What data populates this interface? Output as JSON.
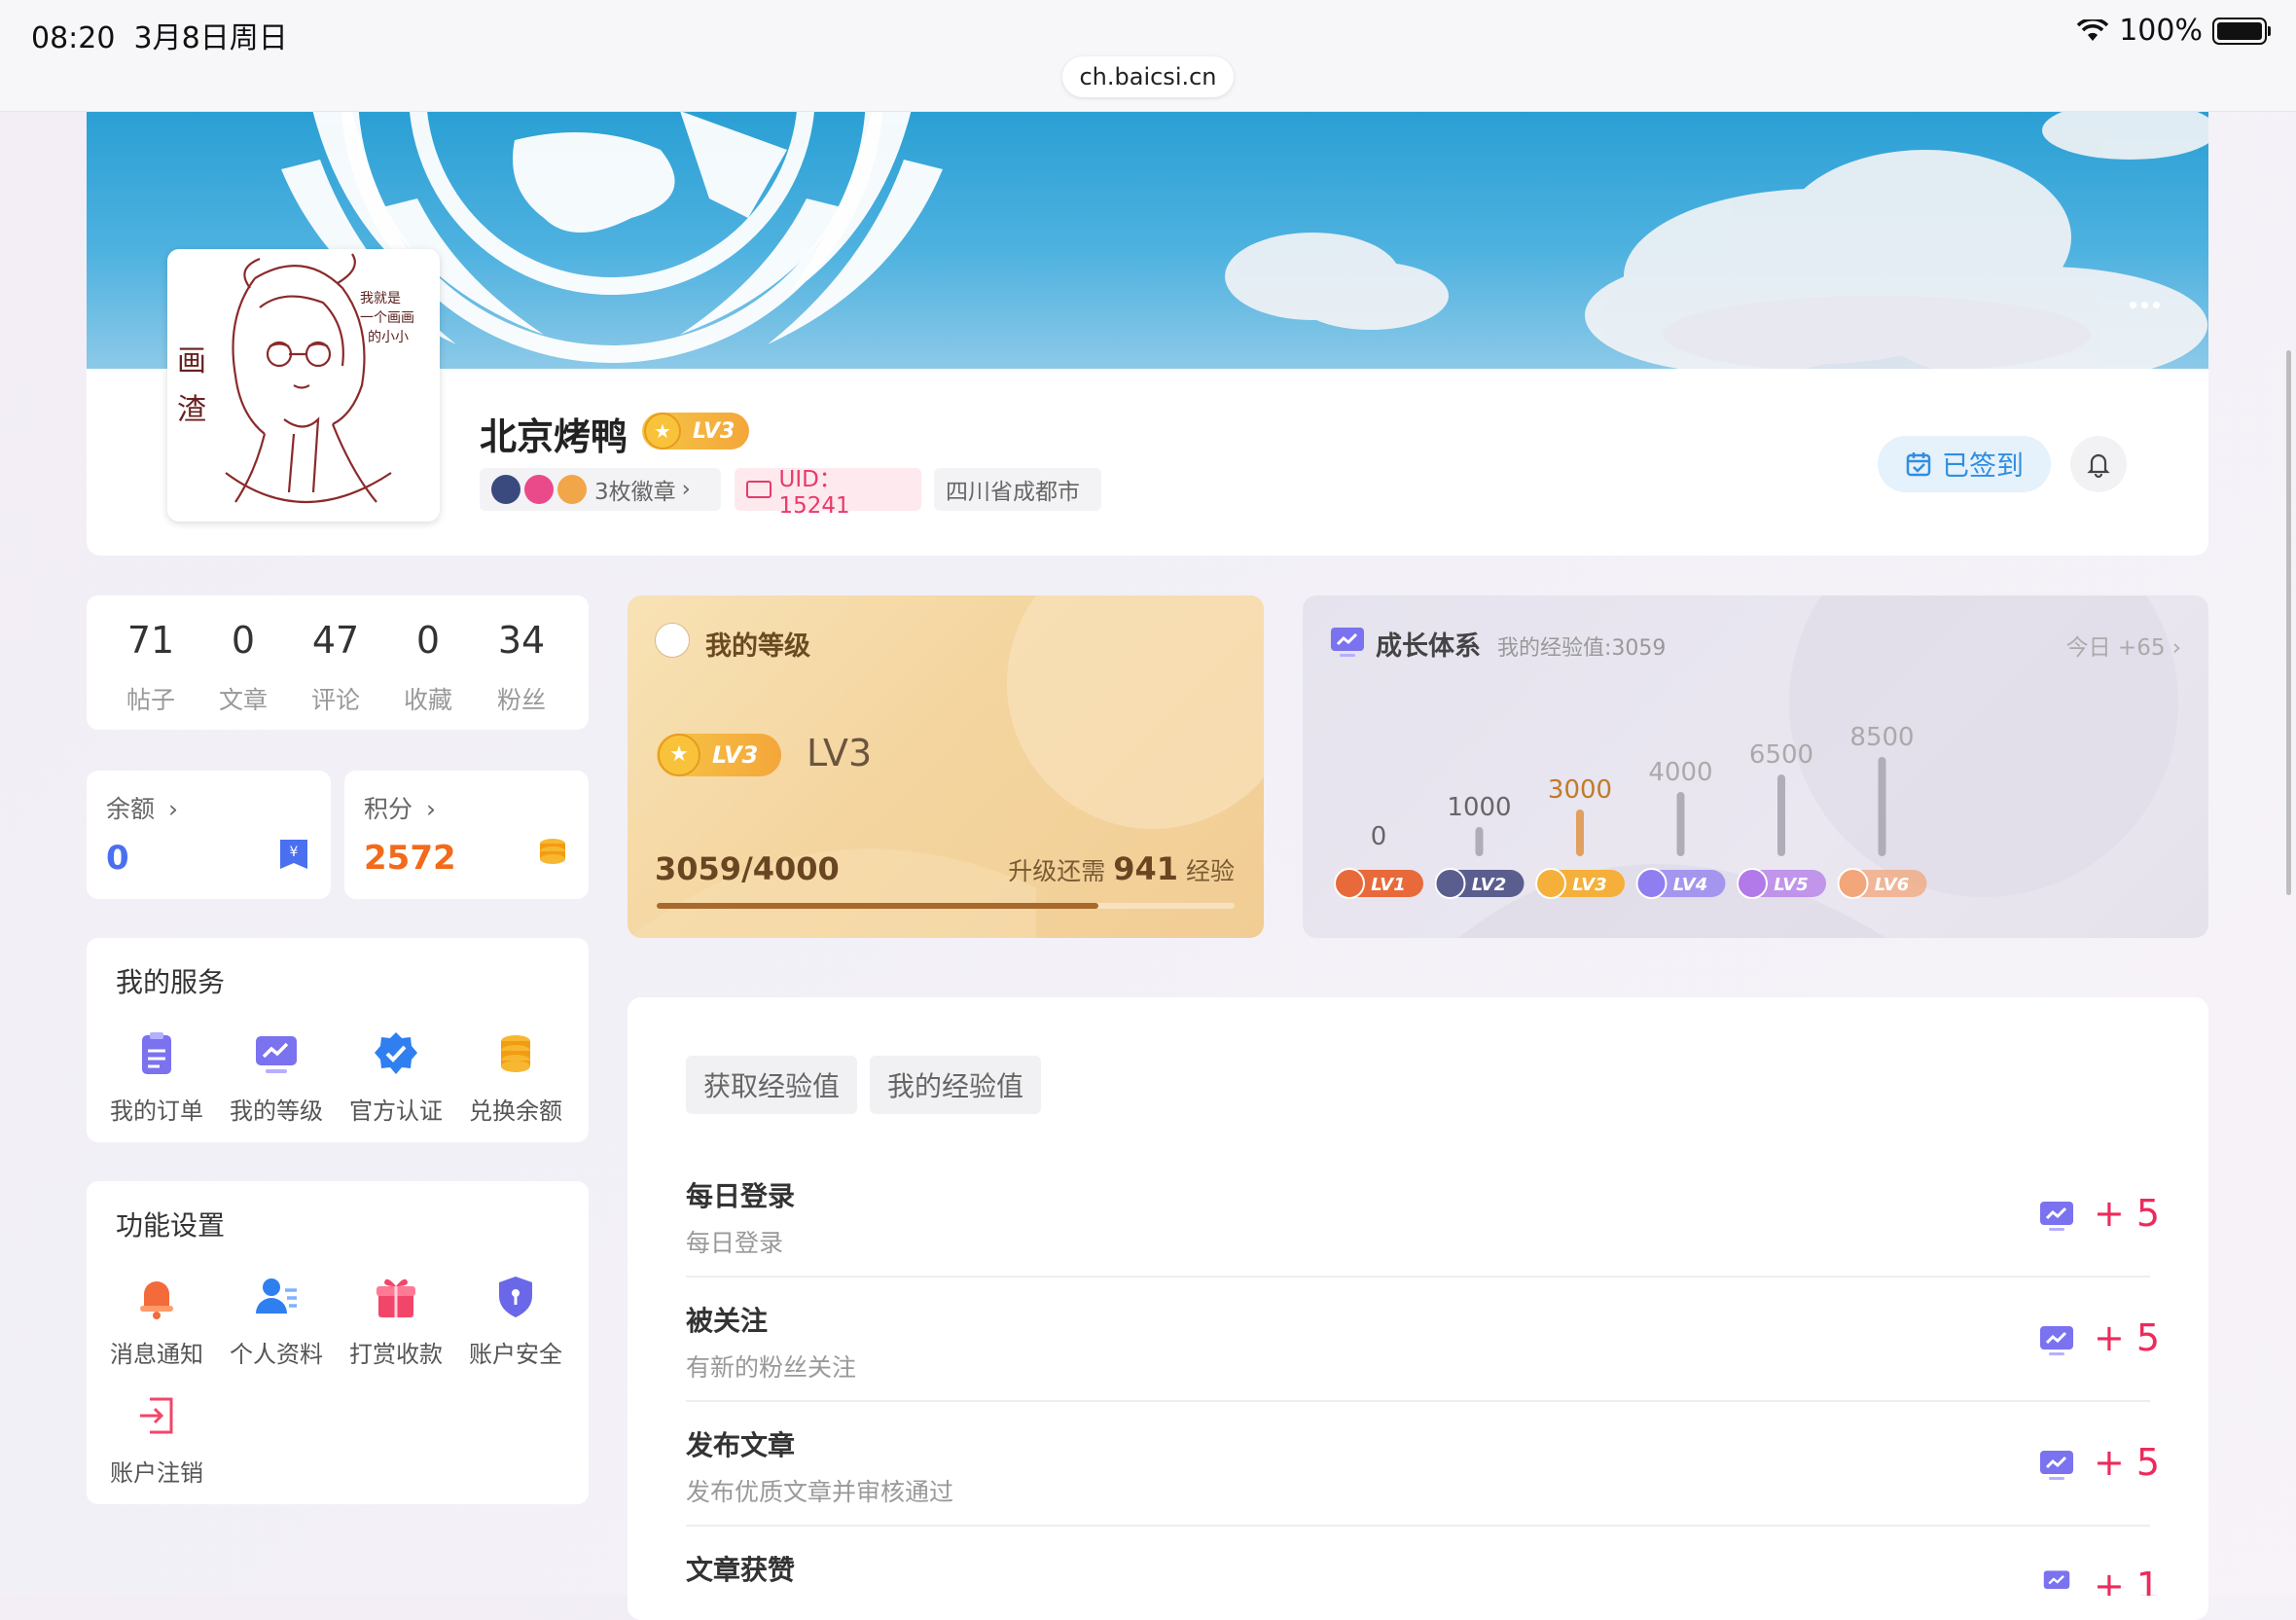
{
  "status_bar": {
    "time": "08:20",
    "date": "3月8日周日",
    "battery": "100%",
    "url": "ch.baicsi.cn"
  },
  "profile": {
    "username": "北京烤鸭",
    "level_badge": "LV3",
    "badges_label": "3枚徽章",
    "uid_label": "UID：15241",
    "location": "四川省成都市",
    "checkin_label": "已签到",
    "avatar_text": [
      "我就是",
      "一个画画",
      "的小小",
      "画",
      "渣"
    ]
  },
  "stats": [
    {
      "value": "71",
      "label": "帖子"
    },
    {
      "value": "0",
      "label": "文章"
    },
    {
      "value": "47",
      "label": "评论"
    },
    {
      "value": "0",
      "label": "收藏"
    },
    {
      "value": "34",
      "label": "粉丝"
    }
  ],
  "wallet": {
    "balance_label": "余额",
    "balance_value": "0",
    "points_label": "积分",
    "points_value": "2572"
  },
  "services": {
    "title": "我的服务",
    "items": [
      {
        "label": "我的订单",
        "icon": "order-icon"
      },
      {
        "label": "我的等级",
        "icon": "level-chart-icon"
      },
      {
        "label": "官方认证",
        "icon": "verified-icon"
      },
      {
        "label": "兑换余额",
        "icon": "coins-icon"
      }
    ]
  },
  "settings": {
    "title": "功能设置",
    "items": [
      {
        "label": "消息通知",
        "icon": "bell-icon"
      },
      {
        "label": "个人资料",
        "icon": "profile-icon"
      },
      {
        "label": "打赏收款",
        "icon": "gift-icon"
      },
      {
        "label": "账户安全",
        "icon": "shield-icon"
      },
      {
        "label": "账户注销",
        "icon": "logout-icon"
      }
    ]
  },
  "level_card": {
    "title": "我的等级",
    "badge": "LV3",
    "level": "LV3",
    "progress_text": "3059/4000",
    "need_prefix": "升级还需",
    "need_value": "941",
    "need_suffix": "经验",
    "progress": 0.7648
  },
  "growth": {
    "title": "成长体系",
    "subtitle": "我的经验值:3059",
    "today": "今日 +65",
    "levels": [
      {
        "badge": "LV1",
        "threshold": "0",
        "color": "#e86a3a"
      },
      {
        "badge": "LV2",
        "threshold": "1000",
        "color": "#5a5e8e"
      },
      {
        "badge": "LV3",
        "threshold": "3000",
        "color": "#f4b03a"
      },
      {
        "badge": "LV4",
        "threshold": "4000",
        "color": "#8f7ef0"
      },
      {
        "badge": "LV5",
        "threshold": "6500",
        "color": "#b27ae8"
      },
      {
        "badge": "LV6",
        "threshold": "8500",
        "color": "#f2a67a"
      }
    ]
  },
  "experience": {
    "tabs": [
      "获取经验值",
      "我的经验值"
    ],
    "tasks": [
      {
        "title": "每日登录",
        "desc": "每日登录",
        "points": "+ 5"
      },
      {
        "title": "被关注",
        "desc": "有新的粉丝关注",
        "points": "+ 5"
      },
      {
        "title": "发布文章",
        "desc": "发布优质文章并审核通过",
        "points": "+ 5"
      },
      {
        "title": "文章获赞",
        "desc": "",
        "points": "+ 1"
      }
    ]
  },
  "colors": {
    "accent_pink": "#ee2a5c",
    "accent_blue": "#2f8ee0",
    "gold": "#f4b03a"
  }
}
